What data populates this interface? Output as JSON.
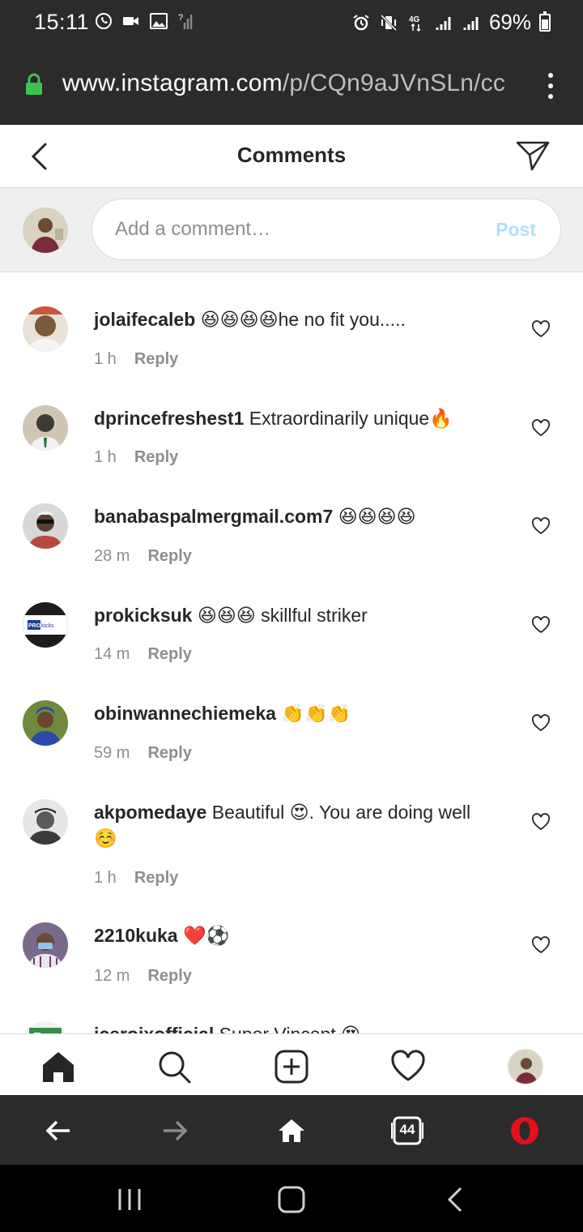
{
  "status_bar": {
    "time": "15:11",
    "battery": "69%",
    "left_icons": [
      "whatsapp-icon",
      "video-call-icon",
      "gallery-icon",
      "no-signal-icon"
    ],
    "right_icons": [
      "alarm-icon",
      "vibrate-icon",
      "4g-icon",
      "signal-icon",
      "signal-icon",
      "battery-icon"
    ]
  },
  "browser": {
    "url_host": "www.instagram.com",
    "url_path": "/p/CQn9aJVnSLn/cc",
    "tab_count": "44"
  },
  "header": {
    "title": "Comments"
  },
  "compose": {
    "placeholder": "Add a comment…",
    "post_label": "Post"
  },
  "comments": [
    {
      "username": "jolaifecaleb",
      "text": "😆😆😆😆he no fit you.....",
      "time": "1 h",
      "reply": "Reply"
    },
    {
      "username": "dprincefreshest1",
      "text": "Extraordinarily unique🔥",
      "time": "1 h",
      "reply": "Reply"
    },
    {
      "username": "banabaspalmergmail.com7",
      "text": "😆😆😆😆",
      "time": "28 m",
      "reply": "Reply"
    },
    {
      "username": "prokicksuk",
      "text": "😆😆😆 skillful striker",
      "time": "14 m",
      "reply": "Reply"
    },
    {
      "username": "obinwannechiemeka",
      "text": "👏👏👏",
      "time": "59 m",
      "reply": "Reply"
    },
    {
      "username": "akpomedaye",
      "text": "Beautiful 😍. You are doing well ☺️",
      "time": "1 h",
      "reply": "Reply"
    },
    {
      "username": "2210kuka",
      "text": "❤️⚽",
      "time": "12 m",
      "reply": "Reply"
    },
    {
      "username": "iceroixofficial",
      "text": "Super Vincent 😍",
      "time": "",
      "reply": ""
    }
  ],
  "avatar_colors": [
    "#7a5a3a",
    "#3d3a36",
    "#b8483c",
    "#1c1c1c",
    "#4a7a3c",
    "#8a8a8a",
    "#6a5a7a",
    "#3a8a4a"
  ],
  "prokicks_logo_text": "PRO kicks"
}
